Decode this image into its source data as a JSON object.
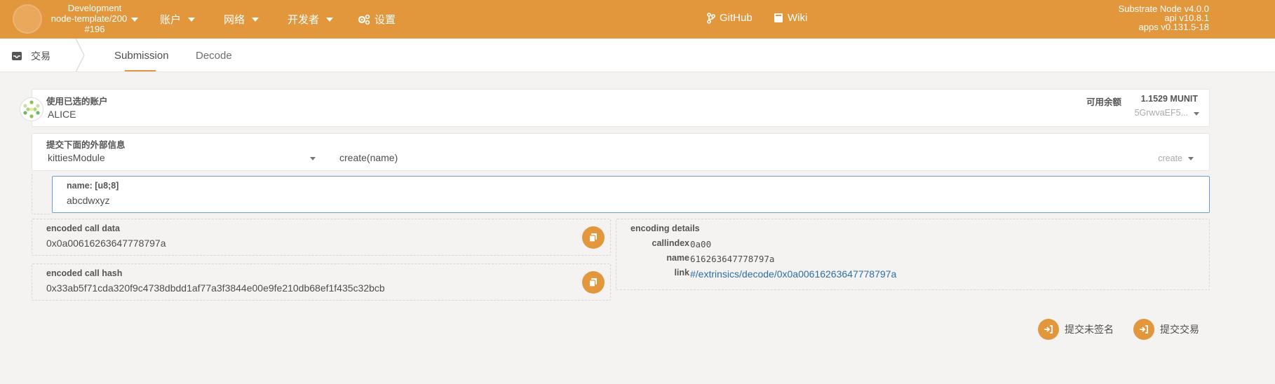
{
  "header": {
    "chain": {
      "line1": "Development",
      "line2": "node-template/200",
      "line3": "#196"
    },
    "menu": [
      {
        "label": "账户",
        "icon": "caret-down-icon"
      },
      {
        "label": "网络",
        "icon": "caret-down-icon"
      },
      {
        "label": "开发者",
        "icon": "caret-down-icon"
      },
      {
        "label": "设置",
        "icon": "gears-icon"
      }
    ],
    "links": [
      {
        "label": "GitHub",
        "icon": "code-branch-icon"
      },
      {
        "label": "Wiki",
        "icon": "book-icon"
      }
    ],
    "version": {
      "node": "Substrate Node v4.0.0",
      "api": "api v10.8.1",
      "apps": "apps v0.131.5-18"
    }
  },
  "subnav": {
    "section": "交易",
    "tabs": [
      "Submission",
      "Decode"
    ],
    "active_tab": "Submission"
  },
  "account": {
    "label": "使用已选的账户",
    "name": "ALICE",
    "balance_label": "可用余额",
    "balance_int": "1.",
    "balance_frac": "1529 MUNIT",
    "address": "5GrwvaEF5..."
  },
  "extrinsic": {
    "label": "提交下面的外部信息",
    "module": "kittiesModule",
    "method": "create(name)",
    "method_short": "create"
  },
  "param": {
    "label": "name: [u8;8]",
    "value": "abcdwxyz"
  },
  "encoded_call": {
    "label": "encoded call data",
    "value": "0x0a00616263647778797a"
  },
  "encoded_hash": {
    "label": "encoded call hash",
    "value": "0x33ab5f71cda320f9c4738dbdd1af77a3f3844e00e9fe210db68ef1f435c32bcb"
  },
  "encoding_details": {
    "label": "encoding details",
    "rows": [
      {
        "key": "callindex",
        "value": "0a00"
      },
      {
        "key": "name",
        "value": "616263647778797a"
      },
      {
        "key": "link",
        "value": "#/extrinsics/decode/0x0a00616263647778797a"
      }
    ]
  },
  "actions": {
    "unsigned": "提交未签名",
    "submit": "提交交易"
  },
  "colors": {
    "accent": "#e2973c",
    "link": "#2e6ea6"
  }
}
